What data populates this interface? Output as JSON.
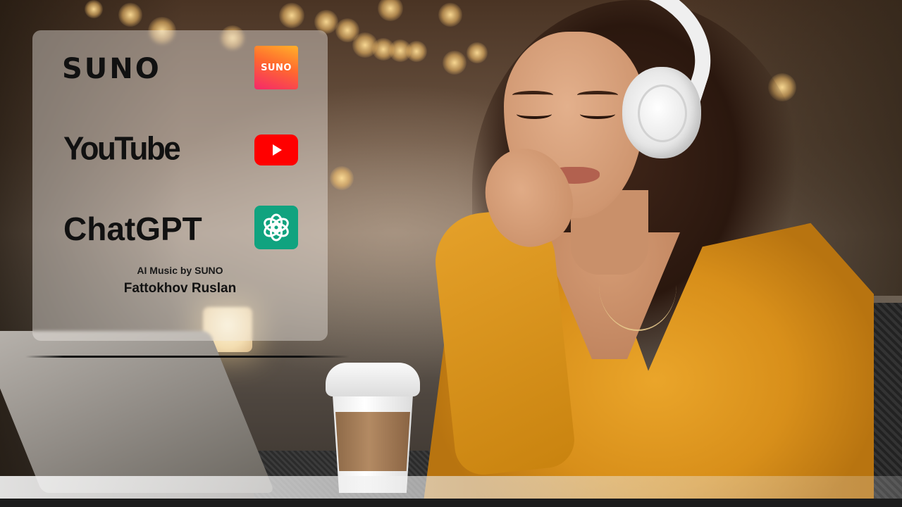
{
  "panel": {
    "rows": [
      {
        "name": "SUNO",
        "icon": "suno-app-icon",
        "icon_label": "SUNO"
      },
      {
        "name": "YouTube",
        "icon": "youtube-play-icon"
      },
      {
        "name": "ChatGPT",
        "icon": "openai-knot-icon"
      }
    ],
    "credit_line": "AI Music by SUNO",
    "author": "Fattokhov Ruslan"
  },
  "colors": {
    "suno_gradient": [
      "#ffb12a",
      "#ff6a2e",
      "#f5286a"
    ],
    "youtube_red": "#ff0000",
    "chatgpt_green": "#10a37f",
    "sweater": "#e39a22"
  }
}
